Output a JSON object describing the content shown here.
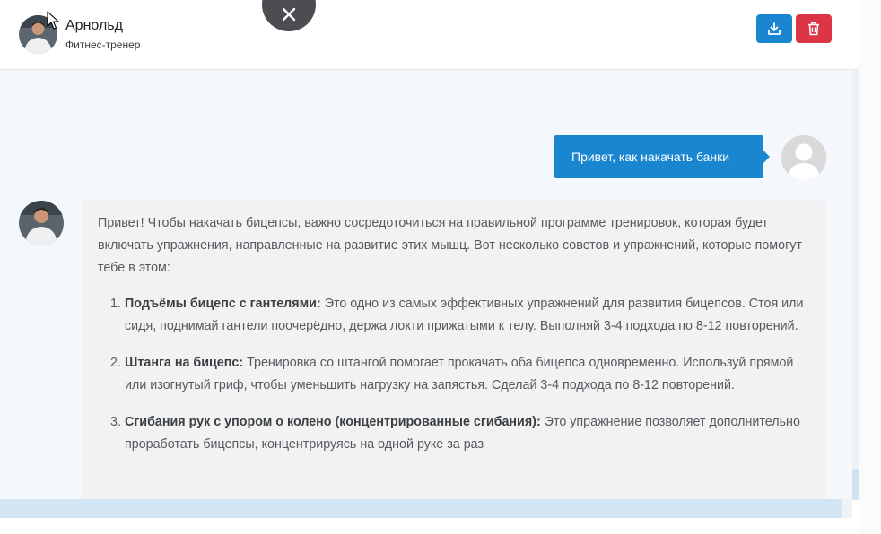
{
  "header": {
    "name": "Арнольд",
    "role": "Фитнес-тренер",
    "download_icon": "download-icon",
    "delete_icon": "trash-icon"
  },
  "overlay": {
    "close_icon": "close-icon"
  },
  "messages": {
    "user": {
      "text": "Привет, как накачать банки"
    },
    "bot": {
      "intro": "Привет! Чтобы накачать бицепсы, важно сосредоточиться на правильной программе тренировок, которая будет включать упражнения, направленные на развитие этих мышц. Вот несколько советов и упражнений, которые помогут тебе в этом:",
      "items": [
        {
          "num": "1.",
          "title": "Подъёмы бицепс с гантелями:",
          "text": " Это одно из самых эффективных упражнений для развития бицепсов. Стоя или сидя, поднимай гантели поочерёдно, держа локти прижатыми к телу. Выполняй 3-4 подхода по 8-12 повторений."
        },
        {
          "num": "2.",
          "title": "Штанга на бицепс:",
          "text": " Тренировка со штангой помогает прокачать оба бицепса одновременно. Используй прямой или изогнутый гриф, чтобы уменьшить нагрузку на запястья. Сделай 3-4 подхода по 8-12 повторений."
        },
        {
          "num": "3.",
          "title": "Сгибания рук с упором о колено (концентрированные сгибания):",
          "text": " Это упражнение позволяет дополнительно проработать бицепсы, концентрируясь на одной руке за раз"
        }
      ]
    }
  },
  "colors": {
    "primary": "#1a86d0",
    "danger": "#dc3545",
    "chat_bg": "#f4f7fb",
    "bubble_bg": "#f2f2f2"
  }
}
